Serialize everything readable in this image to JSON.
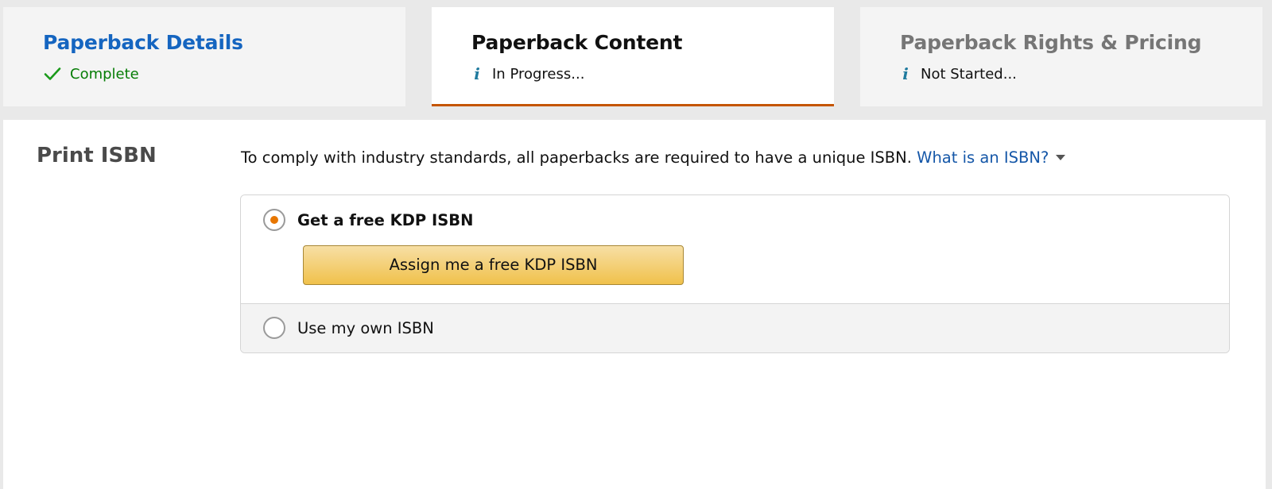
{
  "steps": [
    {
      "title": "Paperback Details",
      "status": "Complete",
      "state": "complete",
      "status_icon": "check-icon"
    },
    {
      "title": "Paperback Content",
      "status": "In Progress...",
      "state": "active",
      "status_icon": "info-icon"
    },
    {
      "title": "Paperback Rights & Pricing",
      "status": "Not Started...",
      "state": "not-started",
      "status_icon": "info-icon"
    }
  ],
  "isbn_section": {
    "label": "Print ISBN",
    "intro_text": "To comply with industry standards, all paperbacks are required to have a unique ISBN.",
    "help_link": "What is an ISBN?",
    "options": [
      {
        "label": "Get a free KDP ISBN",
        "selected": true
      },
      {
        "label": "Use my own ISBN",
        "selected": false
      }
    ],
    "assign_button_label": "Assign me a free KDP ISBN"
  },
  "colors": {
    "link_blue": "#1557a8",
    "complete_green": "#067d06",
    "active_tab_underline": "#c45500",
    "radio_selected": "#e77600",
    "button_yellow": "#f0c14b"
  }
}
